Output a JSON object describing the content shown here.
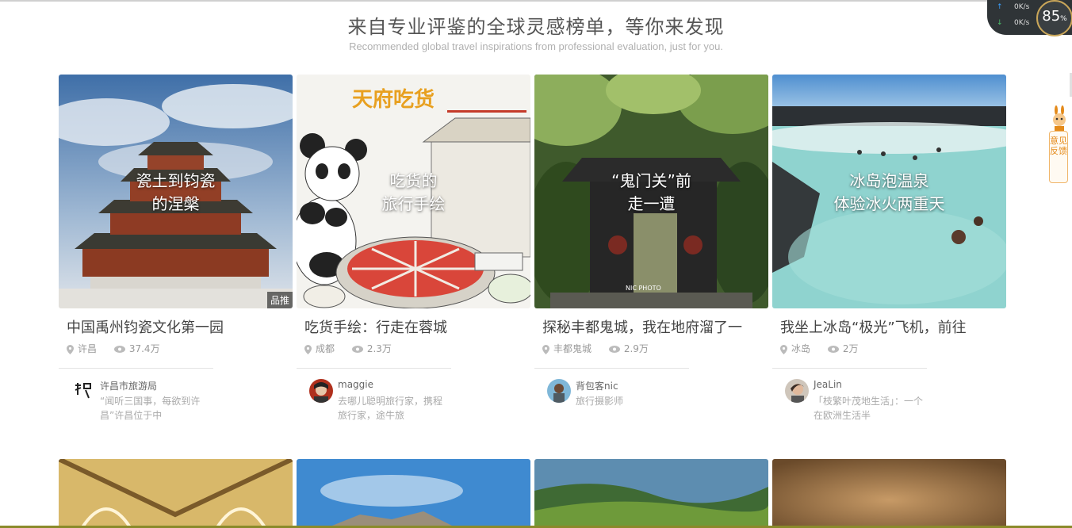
{
  "header": {
    "title": "来自专业评鉴的全球灵感榜单，等你来发现",
    "subtitle": "Recommended global travel inspirations from professional evaluation, just for you."
  },
  "cards": [
    {
      "overlay_line1": "瓷土到钧瓷",
      "overlay_line2": "的涅槃",
      "badge": "品推",
      "title": "中国禹州钧瓷文化第一园",
      "location": "许昌",
      "views": "37.4万",
      "author_name": "许昌市旅游局",
      "author_desc": "“闻听三国事，每欲到许昌”许昌位于中"
    },
    {
      "overlay_line1": "吃货的",
      "overlay_line2": "旅行手绘",
      "title": "吃货手绘：行走在蓉城",
      "location": "成都",
      "views": "2.3万",
      "author_name": "maggie",
      "author_desc": "去哪儿聪明旅行家，携程旅行家，途牛旅"
    },
    {
      "overlay_line1": "“鬼门关”前",
      "overlay_line2": "走一遭",
      "title": "探秘丰都鬼城，我在地府溜了一",
      "location": "丰都鬼城",
      "views": "2.9万",
      "author_name": "背包客nic",
      "author_desc": "旅行摄影师"
    },
    {
      "overlay_line1": "冰岛泡温泉",
      "overlay_line2": "体验冰火两重天",
      "title": "我坐上冰岛“极光”飞机，前往",
      "location": "冰岛",
      "views": "2万",
      "author_name": "JeaLin",
      "author_desc": "「枝繁叶茂地生活」：一个在欧洲生活半"
    }
  ],
  "widget": {
    "upload_speed": "0K/s",
    "download_speed": "0K/s",
    "percent": "85",
    "percent_sign": "%"
  },
  "feedback": {
    "label": "意见反馈"
  },
  "colors": {
    "accent": "#e48a1a",
    "title_text": "#444444",
    "meta_text": "#999999"
  }
}
